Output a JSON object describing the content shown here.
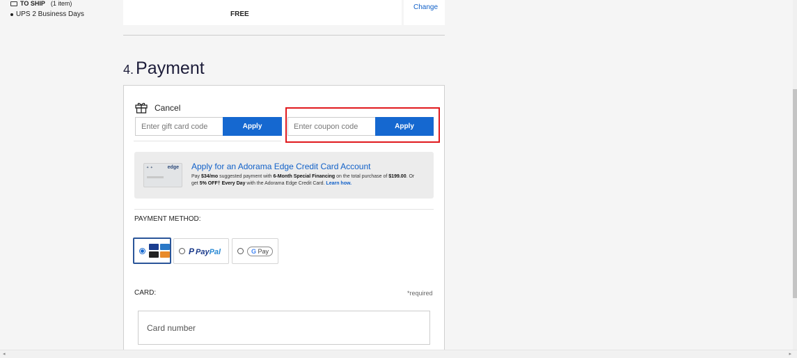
{
  "shipping": {
    "to_ship_label": "TO SHIP",
    "item_count": "(1 item)",
    "method": "UPS 2 Business Days",
    "price": "FREE",
    "change_label": "Change"
  },
  "payment": {
    "number": "4.",
    "title": "Payment",
    "gift": {
      "cancel_label": "Cancel",
      "placeholder": "Enter gift card code",
      "apply_label": "Apply"
    },
    "coupon": {
      "placeholder": "Enter coupon code",
      "apply_label": "Apply"
    },
    "edge": {
      "card_text": "edge",
      "title": "Apply for an Adorama Edge Credit Card Account",
      "desc_1": "Pay ",
      "desc_amount": "$34/mo",
      "desc_2": " suggested payment with ",
      "desc_financing": "6-Month Special Financing",
      "desc_3": " on the total purchase of ",
      "desc_total": "$199.00",
      "desc_4": ". Or get ",
      "desc_off": "5% OFF",
      "desc_dagger": "†",
      "desc_every": " Every Day",
      "desc_5": " with the Adorama Edge Credit Card. ",
      "learn_label": "Learn how."
    },
    "method_label": "PAYMENT METHOD:",
    "methods": {
      "card": "card",
      "paypal_pay": "Pay",
      "paypal_pal": "Pal",
      "gpay": "Pay"
    },
    "card_label": "CARD:",
    "required_note": "*required",
    "card_number_placeholder": "Card number"
  },
  "colors": {
    "accent_blue": "#1568d0",
    "highlight_red": "#e0191d",
    "title_navy": "#1d1d3a"
  }
}
